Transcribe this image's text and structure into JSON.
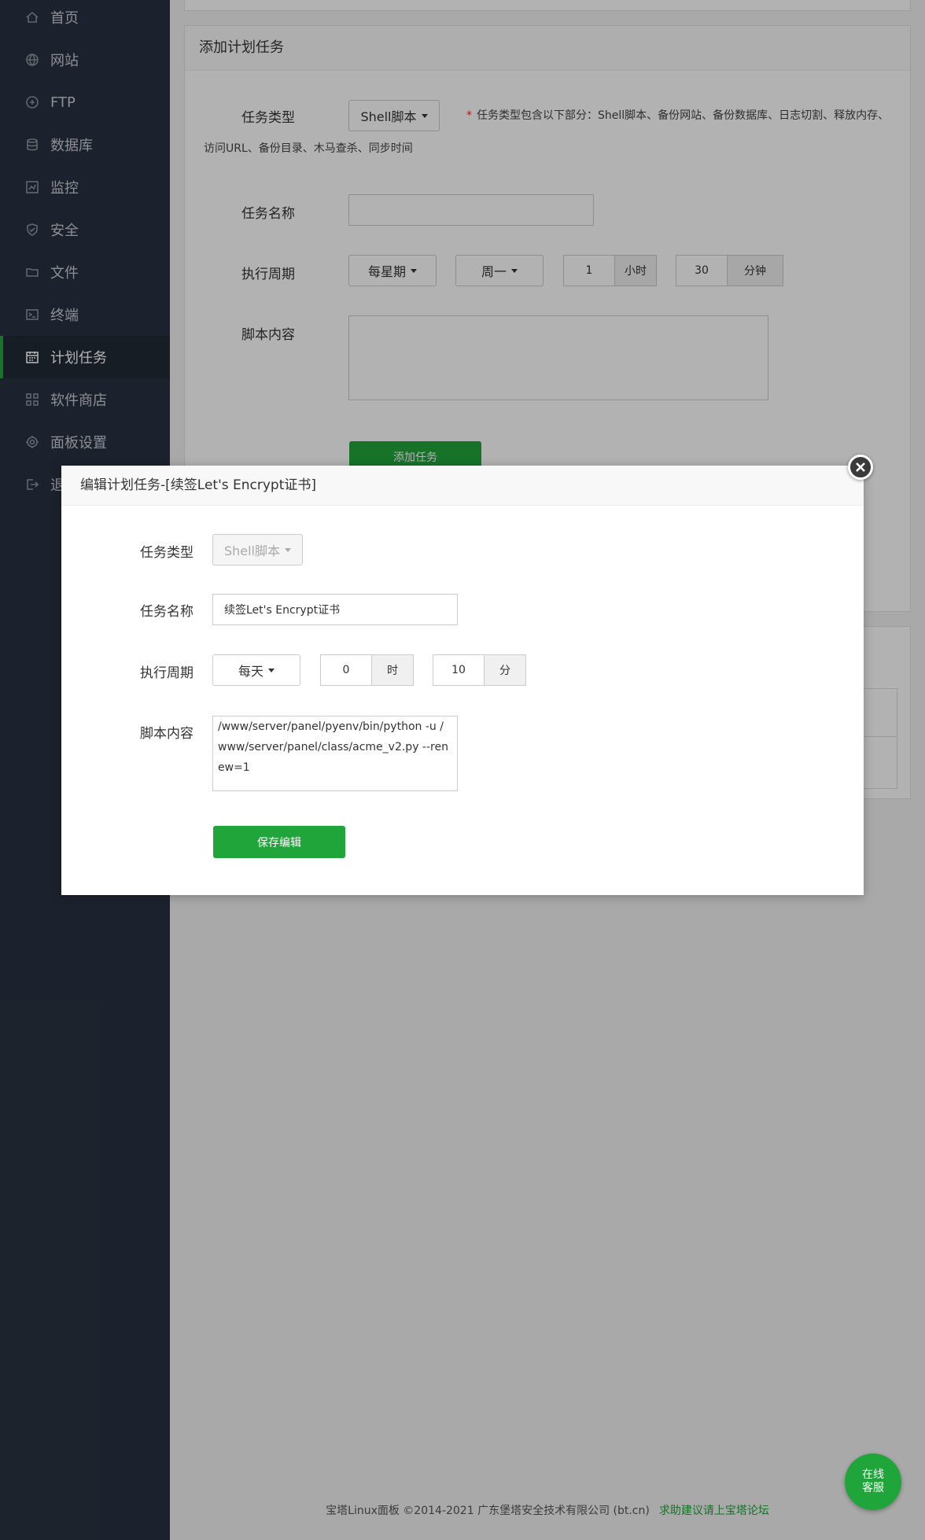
{
  "sidebar": {
    "items": [
      {
        "label": "首页",
        "icon": "home-icon"
      },
      {
        "label": "网站",
        "icon": "globe-icon"
      },
      {
        "label": "FTP",
        "icon": "ftp-icon"
      },
      {
        "label": "数据库",
        "icon": "database-icon"
      },
      {
        "label": "监控",
        "icon": "monitor-icon"
      },
      {
        "label": "安全",
        "icon": "shield-icon"
      },
      {
        "label": "文件",
        "icon": "folder-icon"
      },
      {
        "label": "终端",
        "icon": "terminal-icon"
      },
      {
        "label": "计划任务",
        "icon": "calendar-icon",
        "active": true
      },
      {
        "label": "软件商店",
        "icon": "grid-icon"
      },
      {
        "label": "面板设置",
        "icon": "gear-icon"
      },
      {
        "label": "退出",
        "icon": "logout-icon"
      }
    ]
  },
  "form": {
    "title": "添加计划任务",
    "task_type_label": "任务类型",
    "task_type_value": "Shell脚本",
    "note_line1": "任务类型包含以下部分：Shell脚本、备份网站、备份数据库、日志切割、释放内存、",
    "note_line2": "访问URL、备份目录、木马查杀、同步时间",
    "task_name_label": "任务名称",
    "task_name_value": "",
    "cycle_label": "执行周期",
    "cycle_value": "每星期",
    "weekday_value": "周一",
    "hour_value": "1",
    "hour_unit": "小时",
    "minute_value": "30",
    "minute_unit": "分钟",
    "script_label": "脚本内容",
    "script_value": "",
    "add_button": "添加任务"
  },
  "modal": {
    "title": "编辑计划任务-[续签Let's Encrypt证书]",
    "task_type_label": "任务类型",
    "task_type_value": "Shell脚本",
    "task_name_label": "任务名称",
    "task_name_value": "续签Let's Encrypt证书",
    "cycle_label": "执行周期",
    "cycle_value": "每天",
    "hour_value": "0",
    "hour_unit": "时",
    "minute_value": "10",
    "minute_unit": "分",
    "script_label": "脚本内容",
    "script_value": "/www/server/panel/pyenv/bin/python -u /www/server/panel/class/acme_v2.py --renew=1",
    "save_button": "保存编辑"
  },
  "footer": {
    "copyright": "宝塔Linux面板 ©2014-2021 广东堡塔安全技术有限公司 (bt.cn)",
    "link": "求助建议请上宝塔论坛"
  },
  "support": {
    "line1": "在线",
    "line2": "客服"
  },
  "colors": {
    "accent": "#20a53a",
    "sidebar_bg": "#293241",
    "required": "#e03030"
  }
}
